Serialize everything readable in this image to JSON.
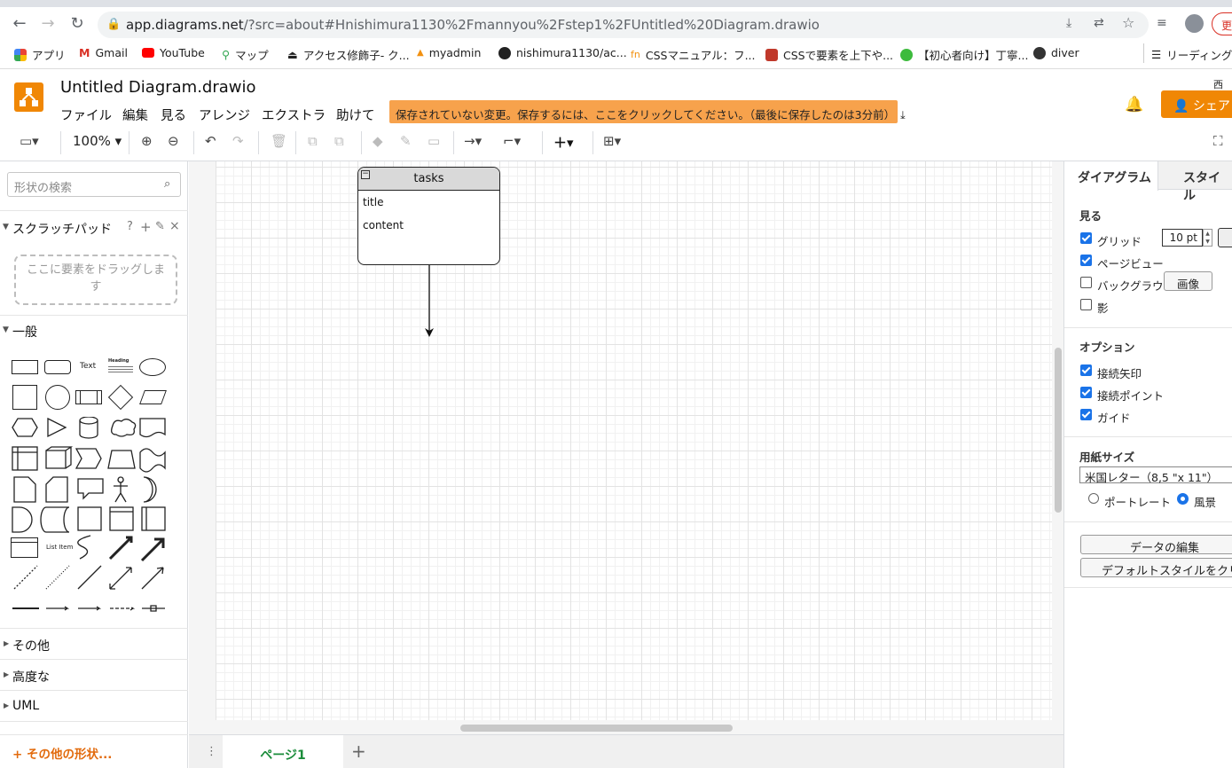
{
  "browser": {
    "url_host": "app.diagrams.net",
    "url_path": "/?src=about#Hnishimura1130%2Fmannyou%2Fstep1%2FUntitled%20Diagram.drawio",
    "bookmarks": [
      "アプリ",
      "Gmail",
      "YouTube",
      "マップ",
      "アクセス修飾子- ク...",
      "myadmin",
      "nishimura1130/ac...",
      "CSSマニュアル：フ...",
      "CSSで要素を上下や...",
      "【初心者向け】丁寧...",
      "diver",
      "リーディング"
    ],
    "update_label": "更"
  },
  "app": {
    "title": "Untitled Diagram.drawio",
    "menus": [
      "ファイル",
      "編集",
      "見る",
      "アレンジ",
      "エクストラ",
      "助けて"
    ],
    "unsaved_notice": "保存されていない変更。保存するには、ここをクリックしてください。（最後に保存したのは3分前）",
    "share_label": "シェア",
    "owner": "西原"
  },
  "toolbar": {
    "zoom": "100%"
  },
  "sidebar": {
    "search_placeholder": "形状の検索",
    "scratchpad": "スクラッチパッド",
    "dropzone": "ここに要素をドラッグします",
    "general": "一般",
    "text_shape": "Text",
    "heading_shape": "Heading",
    "list_item_shape": "List Item",
    "more_sections": [
      "その他",
      "高度な",
      "UML"
    ],
    "more_shapes": "+ その他の形状..."
  },
  "diagram": {
    "table_title": "tasks",
    "rows": [
      "title",
      "content"
    ]
  },
  "pages": {
    "current": "ページ1"
  },
  "format_panel": {
    "tabs": [
      "ダイアグラム",
      "スタイル"
    ],
    "view_heading": "見る",
    "view_options": [
      {
        "label": "グリッド",
        "checked": true
      },
      {
        "label": "ページビュー",
        "checked": true
      },
      {
        "label": "バックグラウ",
        "checked": false
      },
      {
        "label": "影",
        "checked": false
      }
    ],
    "grid_size": "10 pt",
    "image_button": "画像",
    "options_heading": "オプション",
    "options": [
      {
        "label": "接続矢印",
        "checked": true
      },
      {
        "label": "接続ポイント",
        "checked": true
      },
      {
        "label": "ガイド",
        "checked": true
      }
    ],
    "paper_heading": "用紙サイズ",
    "paper_size": "米国レター（8,5 \"x 11\"）",
    "orientation": [
      "ポートレート",
      "風景"
    ],
    "orientation_selected": "風景",
    "edit_data": "データの編集",
    "clear_style": "デフォルトスタイルをクリア"
  },
  "colors": {
    "accent": "#f08705",
    "notice": "#f7a24c",
    "page_tab": "#1a8c3a",
    "check": "#1a73e8"
  }
}
